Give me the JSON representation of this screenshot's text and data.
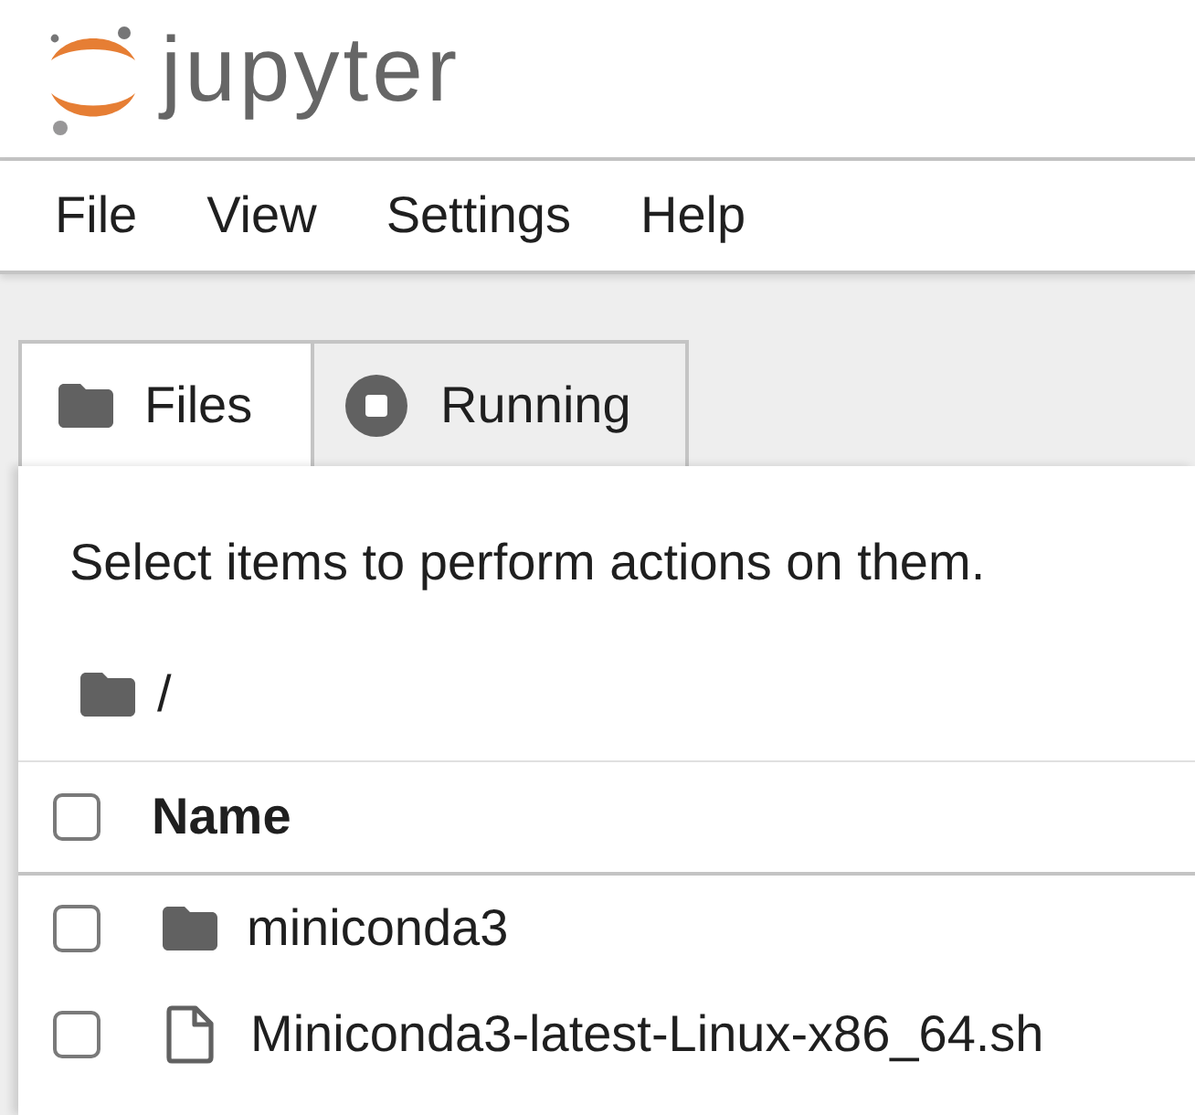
{
  "header": {
    "logo_text": "jupyter"
  },
  "menu": [
    "File",
    "View",
    "Settings",
    "Help"
  ],
  "tabs": [
    {
      "label": "Files",
      "kind": "files",
      "selected": true
    },
    {
      "label": "Running",
      "kind": "running",
      "selected": false
    }
  ],
  "notice": "Select items to perform actions on them.",
  "breadcrumb": {
    "path": "/"
  },
  "file_list": {
    "columns": [
      {
        "label": "Name",
        "checked": false
      }
    ],
    "items": [
      {
        "name": "miniconda3",
        "kind": "directory",
        "checked": false
      },
      {
        "name": "Miniconda3-latest-Linux-x86_64.sh",
        "kind": "file",
        "checked": false
      }
    ]
  }
}
